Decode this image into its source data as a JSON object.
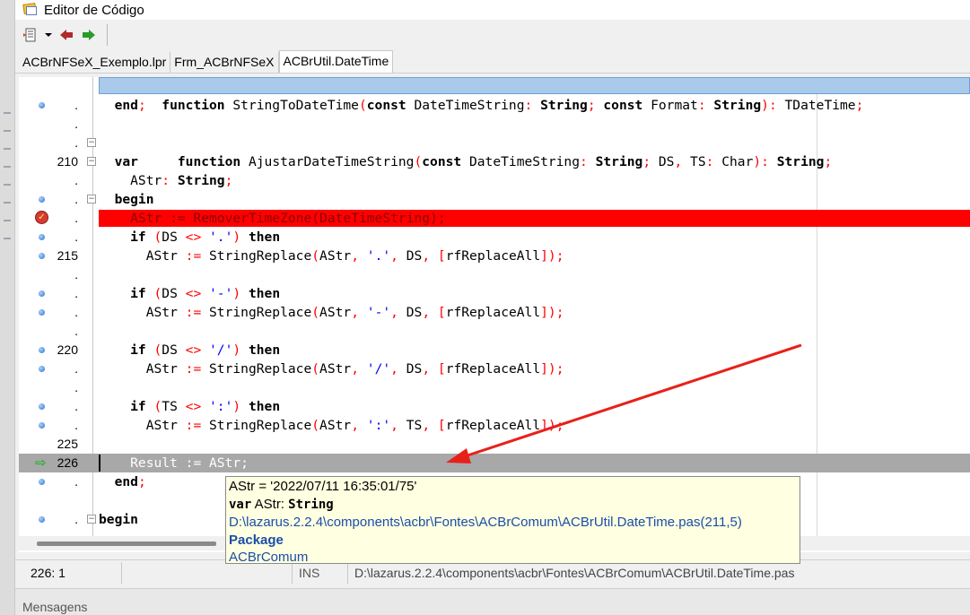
{
  "window": {
    "title": "Editor de Código"
  },
  "toolbar": {
    "items": [
      "menu-icon",
      "dropdown-icon",
      "back-arrow-icon",
      "forward-arrow-icon"
    ]
  },
  "tabs": [
    {
      "label": "ACBrNFSeX_Exemplo.lpr",
      "active": false
    },
    {
      "label": "Frm_ACBrNFSeX",
      "active": false
    },
    {
      "label": "ACBrUtil.DateTime",
      "active": true
    }
  ],
  "gutter_labels": {
    "l210": "210",
    "l215": "215",
    "l220": "220",
    "l225": "225",
    "l226": "226",
    "dot": "."
  },
  "code": {
    "r0": {
      "k1": "function",
      "id1": " StringToDateTime",
      "s1": "(",
      "k2": "const",
      "id2": " DateTimeString",
      "s2": ":",
      "k3": " String",
      "s3": ";",
      "k4": " const",
      "id3": " Format",
      "s4": ":",
      "k5": " String",
      "s5": "):",
      "id4": " TDateTime",
      "s6": ";"
    },
    "r1": {
      "k1": "  end",
      "s1": ";"
    },
    "r3": {
      "k1": "  function",
      "id1": " AjustarDateTimeString",
      "s1": "(",
      "k2": "const",
      "id2": " DateTimeString",
      "s2": ":",
      "k3": " String",
      "s3": ";",
      "id3": " DS",
      "s4": ",",
      "id4": " TS",
      "s5": ":",
      "id5": " Char",
      "s6": "):",
      "k4": " String",
      "s7": ";"
    },
    "r4": {
      "k1": "  var"
    },
    "r5": {
      "id1": "    AStr",
      "s1": ":",
      "k1": " String",
      "s2": ";"
    },
    "r6": {
      "k1": "  begin"
    },
    "r7": {
      "id1": "    AStr ",
      "s1": ":=",
      "id2": " RemoverTimeZone",
      "s2": "(",
      "id3": "DateTimeString",
      "s3": ");"
    },
    "r8": {
      "k1": "    if",
      "s1": " (",
      "id1": "DS ",
      "s2": "<>",
      "str1": " '.'",
      "s3": ")",
      "k2": " then"
    },
    "r9": {
      "id1": "      AStr ",
      "s1": ":=",
      "id2": " StringReplace",
      "s2": "(",
      "id3": "AStr",
      "s3": ",",
      "str1": " '.'",
      "s4": ",",
      "id4": " DS",
      "s5": ",",
      "s6": " [",
      "id5": "rfReplaceAll",
      "s7": "]);"
    },
    "r11": {
      "k1": "    if",
      "s1": " (",
      "id1": "DS ",
      "s2": "<>",
      "str1": " '-'",
      "s3": ")",
      "k2": " then"
    },
    "r12": {
      "id1": "      AStr ",
      "s1": ":=",
      "id2": " StringReplace",
      "s2": "(",
      "id3": "AStr",
      "s3": ",",
      "str1": " '-'",
      "s4": ",",
      "id4": " DS",
      "s5": ",",
      "s6": " [",
      "id5": "rfReplaceAll",
      "s7": "]);"
    },
    "r14": {
      "k1": "    if",
      "s1": " (",
      "id1": "DS ",
      "s2": "<>",
      "str1": " '/'",
      "s3": ")",
      "k2": " then"
    },
    "r15": {
      "id1": "      AStr ",
      "s1": ":=",
      "id2": " StringReplace",
      "s2": "(",
      "id3": "AStr",
      "s3": ",",
      "str1": " '/'",
      "s4": ",",
      "id4": " DS",
      "s5": ",",
      "s6": " [",
      "id5": "rfReplaceAll",
      "s7": "]);"
    },
    "r17": {
      "k1": "    if",
      "s1": " (",
      "id1": "TS ",
      "s2": "<>",
      "str1": " ':'",
      "s3": ")",
      "k2": " then"
    },
    "r18": {
      "id1": "      AStr ",
      "s1": ":=",
      "id2": " StringReplace",
      "s2": "(",
      "id3": "AStr",
      "s3": ",",
      "str1": " ':'",
      "s4": ",",
      "id4": " TS",
      "s5": ",",
      "s6": " [",
      "id5": "rfReplaceAll",
      "s7": "]);"
    },
    "r20": {
      "id1": "    Result ",
      "s1": ":=",
      "id2": " AStr",
      "s2": ";"
    },
    "r21": {
      "k1": "  end",
      "s1": ";"
    },
    "r23": {
      "k1": "begin"
    }
  },
  "tooltip": {
    "value_line": "AStr = '2022/07/11 16:35:01/75'",
    "decl_kw": "var",
    "decl_name": " AStr: ",
    "decl_type": "String",
    "path": "D:\\lazarus.2.2.4\\components\\acbr\\Fontes\\ACBrComum\\ACBrUtil.DateTime.pas(211,5)",
    "package_label": "Package",
    "package_name": "ACBrComum"
  },
  "statusbar": {
    "position": "226:  1",
    "mode": "INS",
    "file": "D:\\lazarus.2.2.4\\components\\acbr\\Fontes\\ACBrComum\\ACBrUtil.DateTime.pas"
  },
  "messages": {
    "label": "Mensagens"
  },
  "colors": {
    "breakpoint_line": "#ff0000",
    "execution_line": "#a8a8a8",
    "selection_line": "#a9caeb",
    "tooltip_bg": "#ffffe1",
    "annotation_arrow": "#e8201a"
  }
}
